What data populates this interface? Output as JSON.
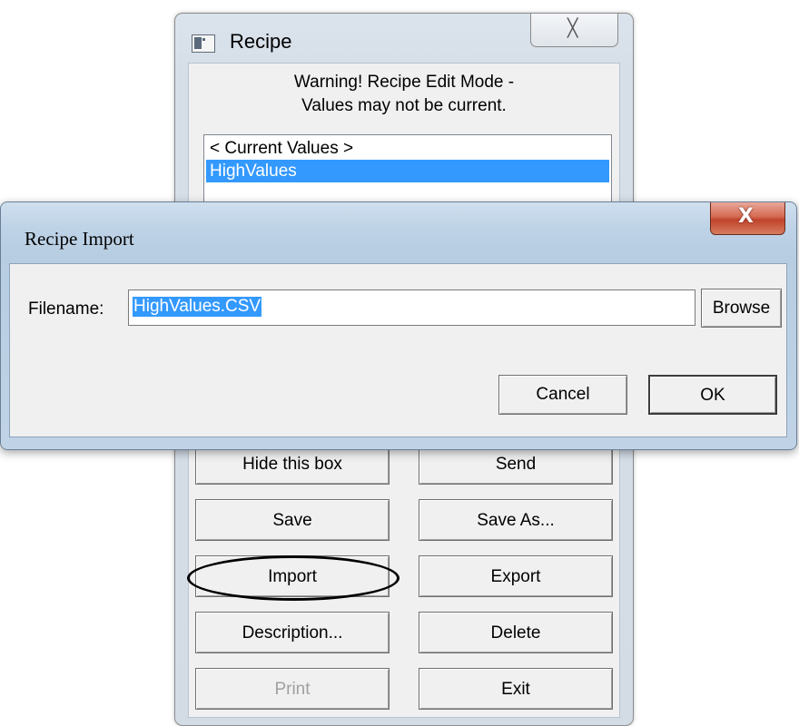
{
  "recipe_window": {
    "title": "Recipe",
    "close_glyph": "╳",
    "warning_line1": "Warning! Recipe Edit Mode -",
    "warning_line2": "Values may not be current.",
    "list_items": [
      "< Current Values >",
      "HighValues"
    ],
    "selected_item": "HighValues",
    "buttons": {
      "hide": "Hide this box",
      "send": "Send",
      "save": "Save",
      "save_as": "Save As...",
      "import": "Import",
      "export": "Export",
      "description": "Description...",
      "delete": "Delete",
      "print": "Print",
      "exit": "Exit"
    },
    "disabled_buttons": [
      "Print"
    ],
    "highlighted_button": "Import"
  },
  "import_dialog": {
    "title": "Recipe Import",
    "close_glyph": "X",
    "filename_label": "Filename:",
    "filename_value": "HighValues.CSV",
    "browse_label": "Browse",
    "cancel_label": "Cancel",
    "ok_label": "OK"
  },
  "colors": {
    "selection": "#3399ff",
    "close_button_red": "#c0432c",
    "dialog_frame": "#b7cde2"
  },
  "icons": {
    "recipe_app_icon": "window-icon",
    "close_icon": "close-icon"
  }
}
